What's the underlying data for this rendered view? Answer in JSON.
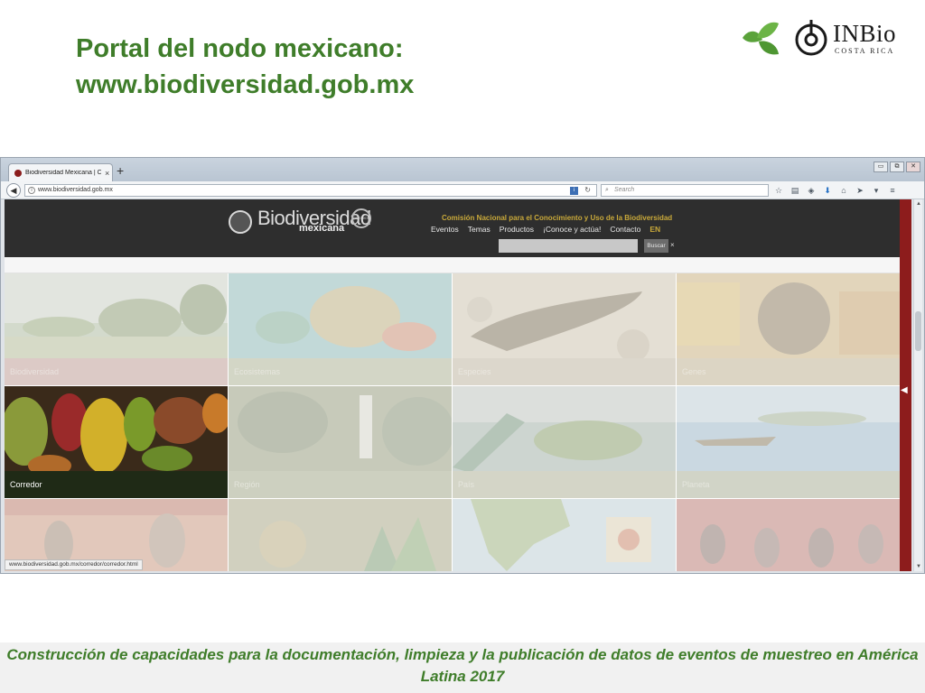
{
  "slide": {
    "title_line1": "Portal del nodo mexicano:",
    "title_line2": "www.biodiversidad.gob.mx",
    "inbio_name": "INBio",
    "inbio_sub": "COSTA RICA",
    "footer": "Construcción de capacidades para la documentación, limpieza y la publicación de datos de eventos de muestreo en América Latina 2017"
  },
  "browser": {
    "tab_title": "Biodiversidad Mexicana | C...",
    "tab_close": "×",
    "new_tab": "+",
    "url": "www.biodiversidad.gob.mx",
    "search_placeholder": "Search",
    "status_url": "www.biodiversidad.gob.mx/corredor/corredor.html",
    "window_buttons": [
      "▭",
      "⧉",
      "✕"
    ],
    "toolbar_icons": [
      "star-icon",
      "reading-list-icon",
      "pocket-icon",
      "download-icon",
      "home-icon",
      "send-icon",
      "overflow-icon",
      "menu-icon"
    ]
  },
  "site": {
    "logo_text": "Biodiversidad",
    "logo_sub": "mexicana",
    "premios": "PREMIOS",
    "org_title": "Comisión Nacional para el Conocimiento y Uso de la Biodiversidad",
    "menu": [
      "Eventos",
      "Temas",
      "Productos",
      "¡Conoce y actúa!",
      "Contacto"
    ],
    "menu_en": "EN",
    "search_button": "Buscar",
    "search_close": "×",
    "accent_color": "#8d1c1c",
    "tiles": [
      {
        "caption": "Biodiversidad",
        "active": false
      },
      {
        "caption": "Ecosistemas",
        "active": false
      },
      {
        "caption": "Especies",
        "active": false
      },
      {
        "caption": "Genes",
        "active": false
      },
      {
        "caption": "Corredor",
        "active": true
      },
      {
        "caption": "Región",
        "active": false
      },
      {
        "caption": "País",
        "active": false
      },
      {
        "caption": "Planeta",
        "active": false
      },
      {
        "caption": "",
        "active": false
      },
      {
        "caption": "",
        "active": false
      },
      {
        "caption": "",
        "active": false
      },
      {
        "caption": "",
        "active": false
      }
    ]
  },
  "colors": {
    "title_green": "#3f7d2a",
    "conabio_gold": "#c9a93a"
  }
}
